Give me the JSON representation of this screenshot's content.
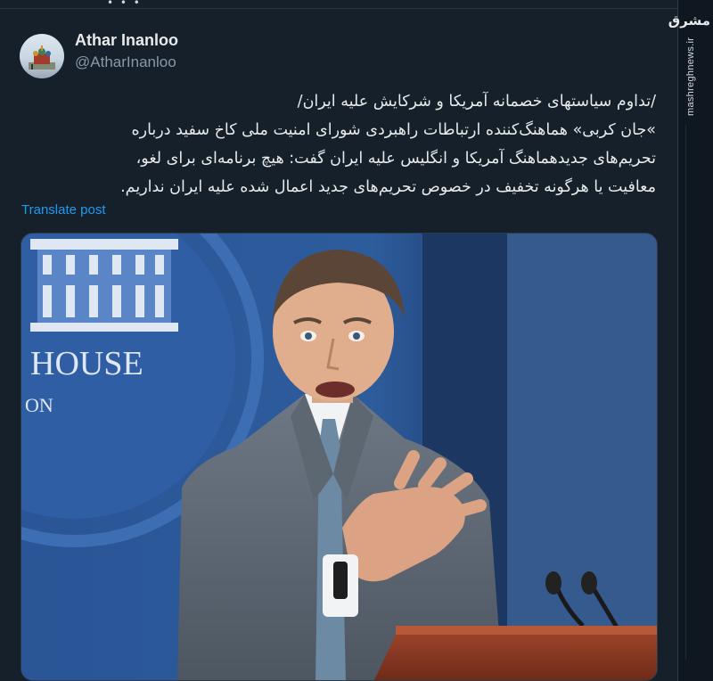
{
  "tweet": {
    "author_name": "Athar Inanloo",
    "author_handle": "@AtharInanloo",
    "text_lines": [
      "/تداوم سیاستهای خصمانه آمریکا و شرکایش علیه ایران/",
      "»جان کربی» هماهنگ‌کننده ارتباطات راهبردی شورای امنیت ملی کاخ سفید درباره",
      "تحریم‌های جدیدهماهنگ آمریکا و انگلیس علیه ایران گفت: هیچ برنامه‌ای برای لغو،",
      "معافیت یا هرگونه تخفیف در خصوص تحریم‌های جدید اعمال شده علیه ایران نداریم."
    ],
    "translate_label": "Translate post",
    "media": {
      "sign_text_top": "HOUSE",
      "sign_text_bottom": "ON"
    }
  },
  "watermark": {
    "logo_text": "مشرق",
    "site": "mashreghnews.ir"
  },
  "colors": {
    "background": "#15202b",
    "link": "#1d9bf0",
    "muted": "#8b98a5",
    "text": "#e7e9ea"
  },
  "icons": {
    "avatar": "avatar-photo",
    "watermark": "mashregh-logo"
  }
}
